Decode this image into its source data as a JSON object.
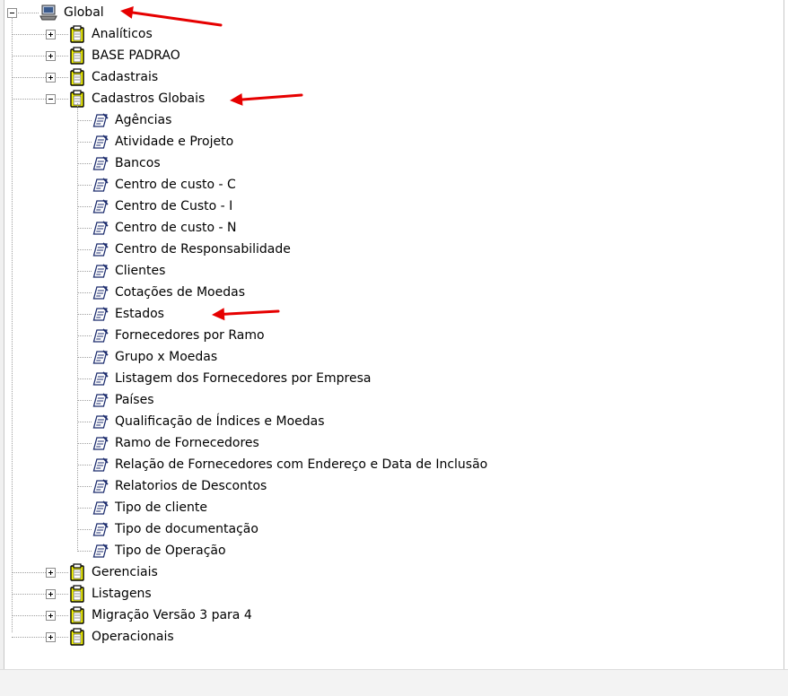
{
  "tree": {
    "root": {
      "label": "Global",
      "icon": "computer-icon",
      "expanded": true
    },
    "groups": [
      {
        "label": "Analíticos",
        "expanded": false
      },
      {
        "label": "BASE PADRAO",
        "expanded": false
      },
      {
        "label": "Cadastrais",
        "expanded": false
      },
      {
        "label": "Cadastros Globais",
        "expanded": true,
        "items": [
          "Agências",
          "Atividade e Projeto",
          "Bancos",
          "Centro de custo - C",
          "Centro de Custo - I",
          "Centro de custo - N",
          "Centro de Responsabilidade",
          "Clientes",
          "Cotações de Moedas",
          "Estados",
          "Fornecedores por Ramo",
          "Grupo x Moedas",
          "Listagem dos Fornecedores por Empresa",
          "Países",
          "Qualificação de Índices e Moedas",
          "Ramo de Fornecedores",
          "Relação de Fornecedores com Endereço e Data de Inclusão",
          "Relatorios de Descontos",
          "Tipo de cliente",
          "Tipo de documentação",
          "Tipo de Operação"
        ]
      },
      {
        "label": "Gerenciais",
        "expanded": false
      },
      {
        "label": "Listagens",
        "expanded": false
      },
      {
        "label": "Migração Versão 3 para 4",
        "expanded": false
      },
      {
        "label": "Operacionais",
        "expanded": false
      }
    ]
  },
  "colors": {
    "folder_fill": "#ffff00",
    "folder_stroke": "#000000",
    "annotation_arrow": "#e60000",
    "tree_line": "#a0a0a0"
  },
  "icons": {
    "group": "folder-clipboard-icon",
    "report": "report-pencil-icon",
    "root": "computer-icon"
  }
}
